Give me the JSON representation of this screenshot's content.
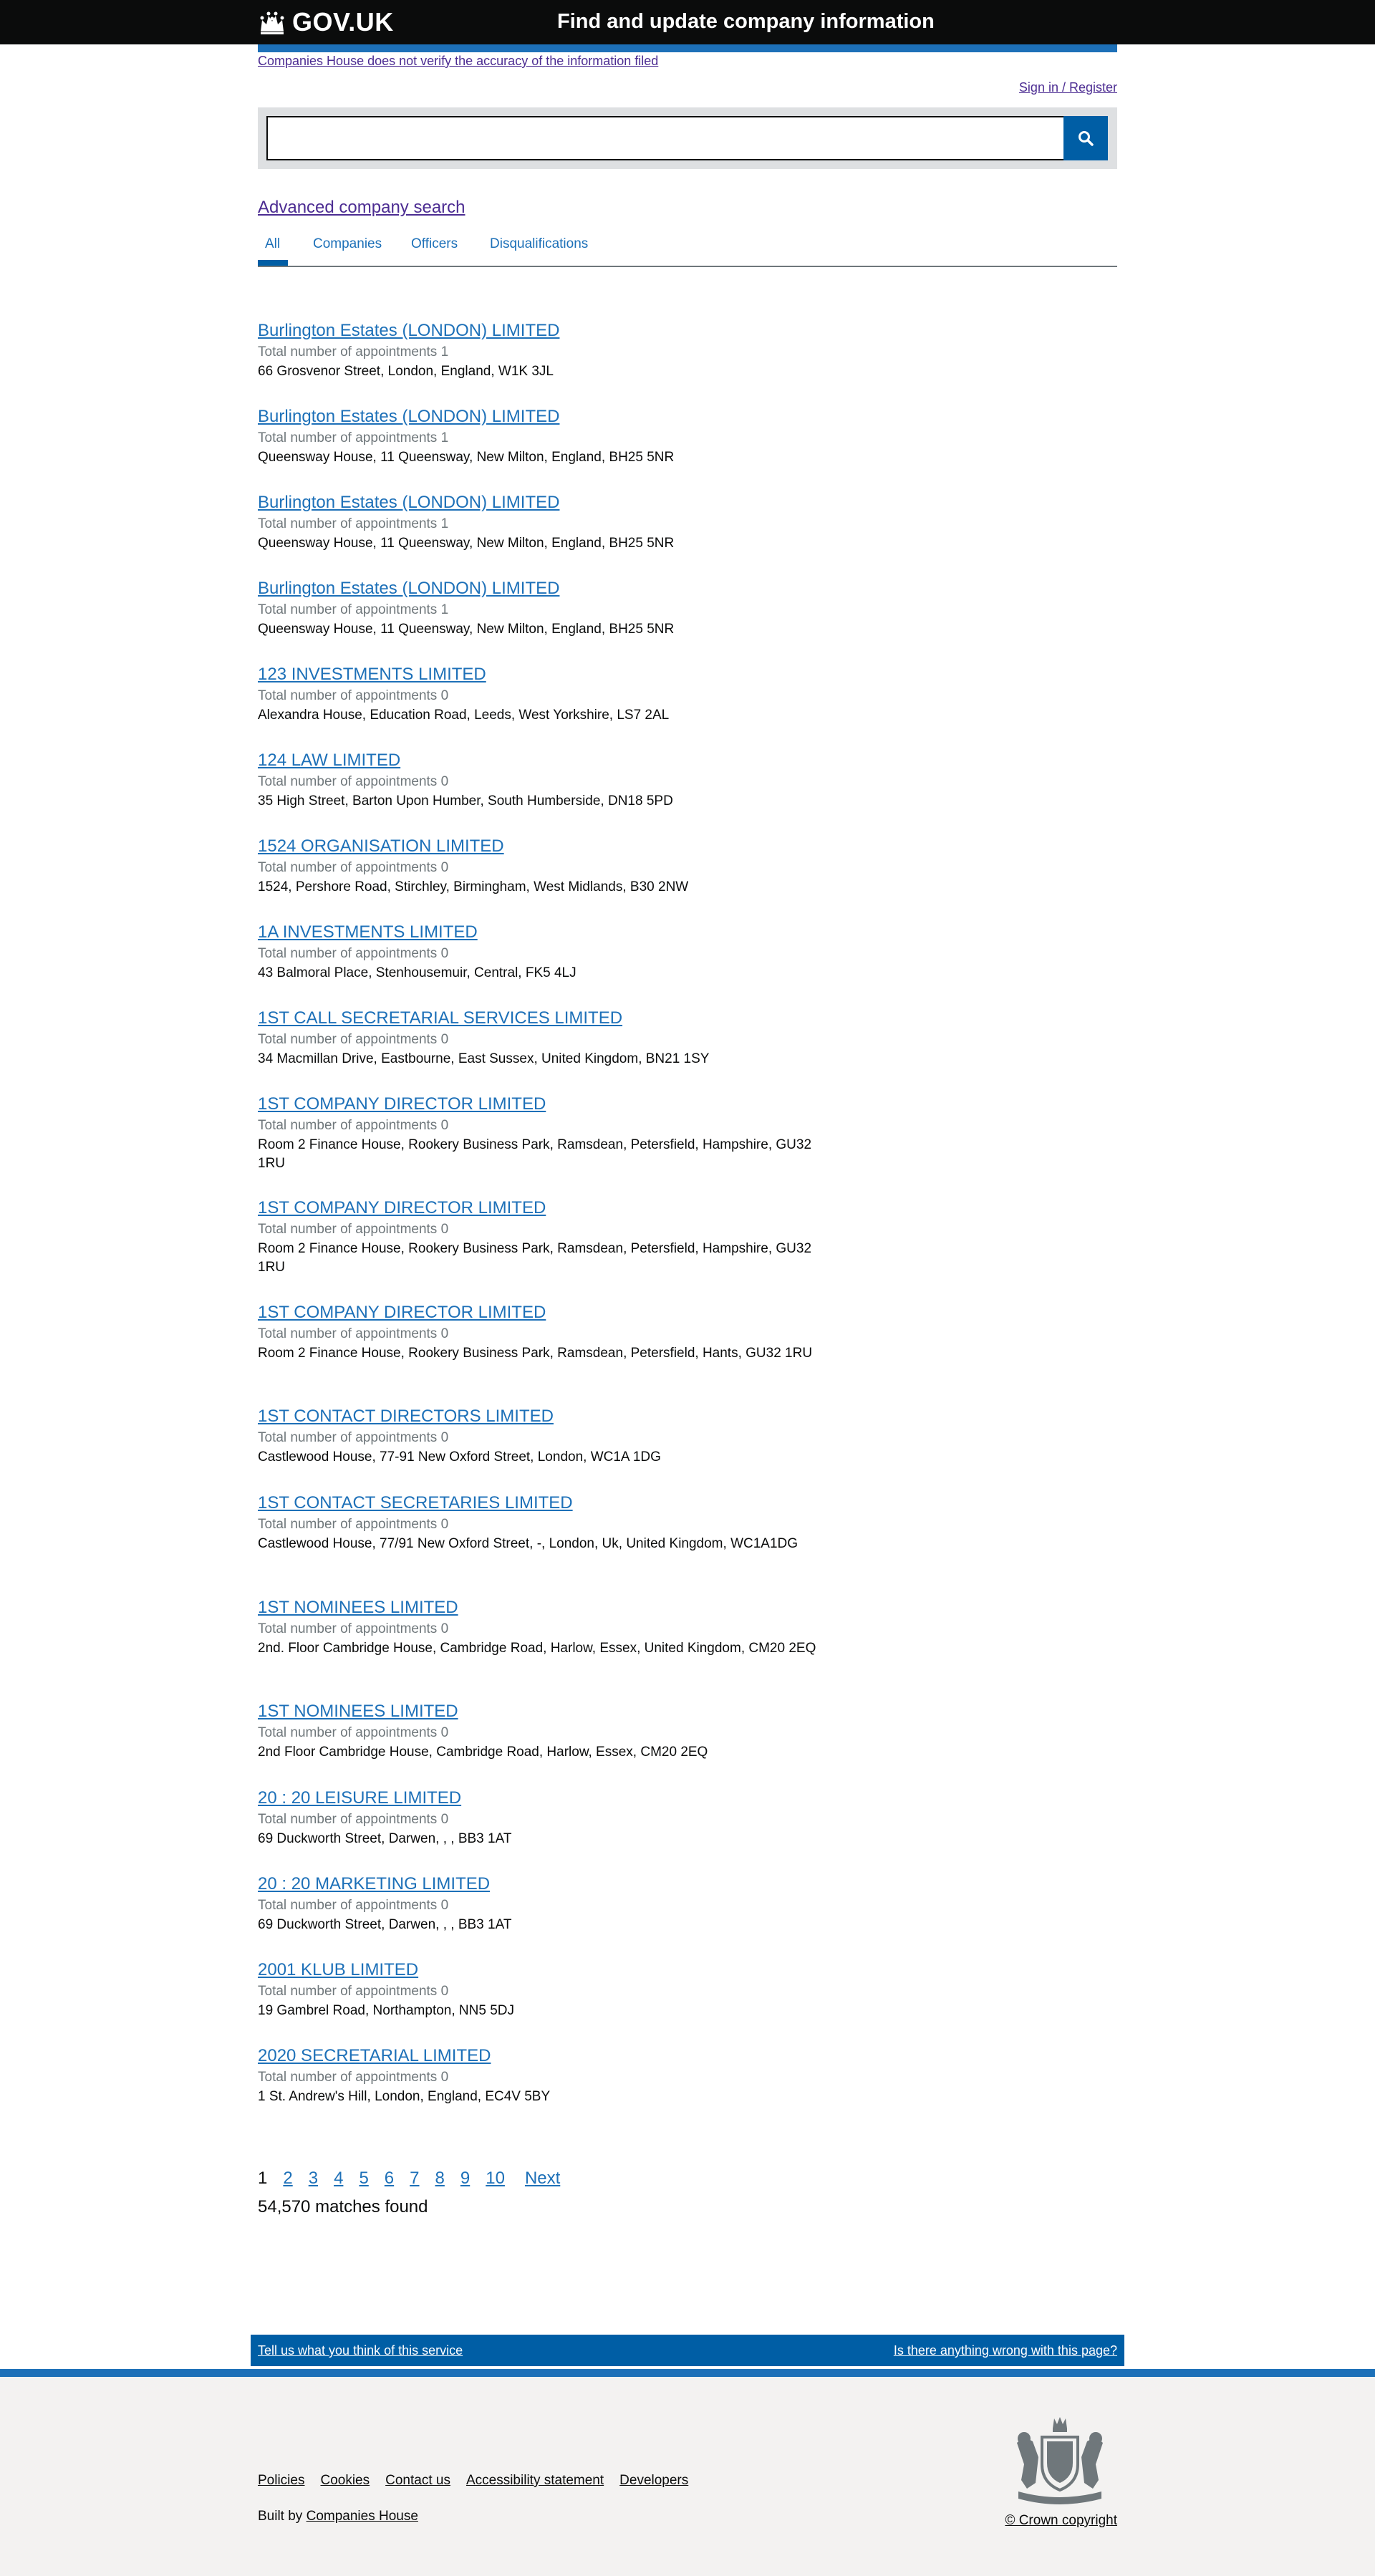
{
  "header": {
    "logo_text": "GOV.UK",
    "service_name": "Find and update company information"
  },
  "phase_banner": {
    "text": "Companies House does not verify the accuracy of the information filed"
  },
  "account": {
    "sign_in_label": "Sign in / Register"
  },
  "search": {
    "value": "",
    "button_icon": "search-icon"
  },
  "advanced_search_label": "Advanced company search",
  "tabs": [
    {
      "label": "All",
      "active": true
    },
    {
      "label": "Companies",
      "active": false
    },
    {
      "label": "Officers",
      "active": false
    },
    {
      "label": "Disqualifications",
      "active": false
    }
  ],
  "results": [
    {
      "title": "Burlington Estates (LONDON) LIMITED",
      "appointments": "Total number of appointments 1",
      "address": "66 Grosvenor Street, London, England, W1K 3JL"
    },
    {
      "title": "Burlington Estates (LONDON) LIMITED",
      "appointments": "Total number of appointments 1",
      "address": "Queensway House, 11 Queensway, New Milton, England, BH25 5NR"
    },
    {
      "title": "Burlington Estates (LONDON) LIMITED",
      "appointments": "Total number of appointments 1",
      "address": "Queensway House, 11 Queensway, New Milton, England, BH25 5NR"
    },
    {
      "title": "Burlington Estates (LONDON) LIMITED",
      "appointments": "Total number of appointments 1",
      "address": "Queensway House, 11 Queensway, New Milton, England, BH25 5NR"
    },
    {
      "title": "123 INVESTMENTS LIMITED",
      "appointments": "Total number of appointments 0",
      "address": "Alexandra House, Education Road, Leeds, West Yorkshire, LS7 2AL"
    },
    {
      "title": "124 LAW LIMITED",
      "appointments": "Total number of appointments 0",
      "address": "35 High Street, Barton Upon Humber, South Humberside, DN18 5PD"
    },
    {
      "title": "1524 ORGANISATION LIMITED",
      "appointments": "Total number of appointments 0",
      "address": "1524, Pershore Road, Stirchley, Birmingham, West Midlands, B30 2NW"
    },
    {
      "title": "1A INVESTMENTS LIMITED",
      "appointments": "Total number of appointments 0",
      "address": "43 Balmoral Place, Stenhousemuir, Central, FK5 4LJ"
    },
    {
      "title": "1ST CALL SECRETARIAL SERVICES LIMITED",
      "appointments": "Total number of appointments 0",
      "address": "34 Macmillan Drive, Eastbourne, East Sussex, United Kingdom, BN21 1SY"
    },
    {
      "title": "1ST COMPANY DIRECTOR LIMITED",
      "appointments": "Total number of appointments 0",
      "address": "Room 2 Finance House, Rookery Business Park, Ramsdean, Petersfield, Hampshire, GU32 1RU"
    },
    {
      "title": "1ST COMPANY DIRECTOR LIMITED",
      "appointments": "Total number of appointments 0",
      "address": "Room 2 Finance House, Rookery Business Park, Ramsdean, Petersfield, Hampshire, GU32 1RU"
    },
    {
      "title": "1ST COMPANY DIRECTOR LIMITED",
      "appointments": "Total number of appointments 0",
      "address": "Room 2 Finance House, Rookery Business Park, Ramsdean, Petersfield, Hants, GU32 1RU"
    },
    {
      "title": "1ST CONTACT DIRECTORS LIMITED",
      "appointments": "Total number of appointments 0",
      "address": "Castlewood House, 77-91 New Oxford Street, London, WC1A 1DG"
    },
    {
      "title": "1ST CONTACT SECRETARIES LIMITED",
      "appointments": "Total number of appointments 0",
      "address": "Castlewood House, 77/91 New Oxford Street, -, London, Uk, United Kingdom, WC1A1DG"
    },
    {
      "title": "1ST NOMINEES LIMITED",
      "appointments": "Total number of appointments 0",
      "address": "2nd. Floor Cambridge House, Cambridge Road, Harlow, Essex, United Kingdom, CM20 2EQ"
    },
    {
      "title": "1ST NOMINEES LIMITED",
      "appointments": "Total number of appointments 0",
      "address": "2nd Floor Cambridge House, Cambridge Road, Harlow, Essex, CM20 2EQ"
    },
    {
      "title": "20 : 20 LEISURE LIMITED",
      "appointments": "Total number of appointments 0",
      "address": "69 Duckworth Street, Darwen, , , BB3 1AT"
    },
    {
      "title": "20 : 20 MARKETING LIMITED",
      "appointments": "Total number of appointments 0",
      "address": "69 Duckworth Street, Darwen, , , BB3 1AT"
    },
    {
      "title": "2001 KLUB LIMITED",
      "appointments": "Total number of appointments 0",
      "address": "19 Gambrel Road, Northampton, NN5 5DJ"
    },
    {
      "title": "2020 SECRETARIAL LIMITED",
      "appointments": "Total number of appointments 0",
      "address": "1 St. Andrew's Hill, London, England, EC4V 5BY"
    }
  ],
  "pagination": {
    "current": "1",
    "pages": [
      "2",
      "3",
      "4",
      "5",
      "6",
      "7",
      "8",
      "9",
      "10"
    ],
    "next_label": "Next"
  },
  "matches_text": "54,570 matches found",
  "feedback": {
    "left_label": "Tell us what you think of this service",
    "right_label": "Is there anything wrong with this page?"
  },
  "footer": {
    "links": [
      "Policies",
      "Cookies",
      "Contact us",
      "Accessibility statement",
      "Developers"
    ],
    "built_by_prefix": "Built by ",
    "built_by_link": "Companies House",
    "copyright": "© Crown copyright"
  },
  "colors": {
    "header_bg": "#0b0c0c",
    "link_blue": "#1d70b8",
    "visited_purple": "#4c2c92",
    "search_button": "#005ea5",
    "footer_bg": "#f3f2f1"
  }
}
